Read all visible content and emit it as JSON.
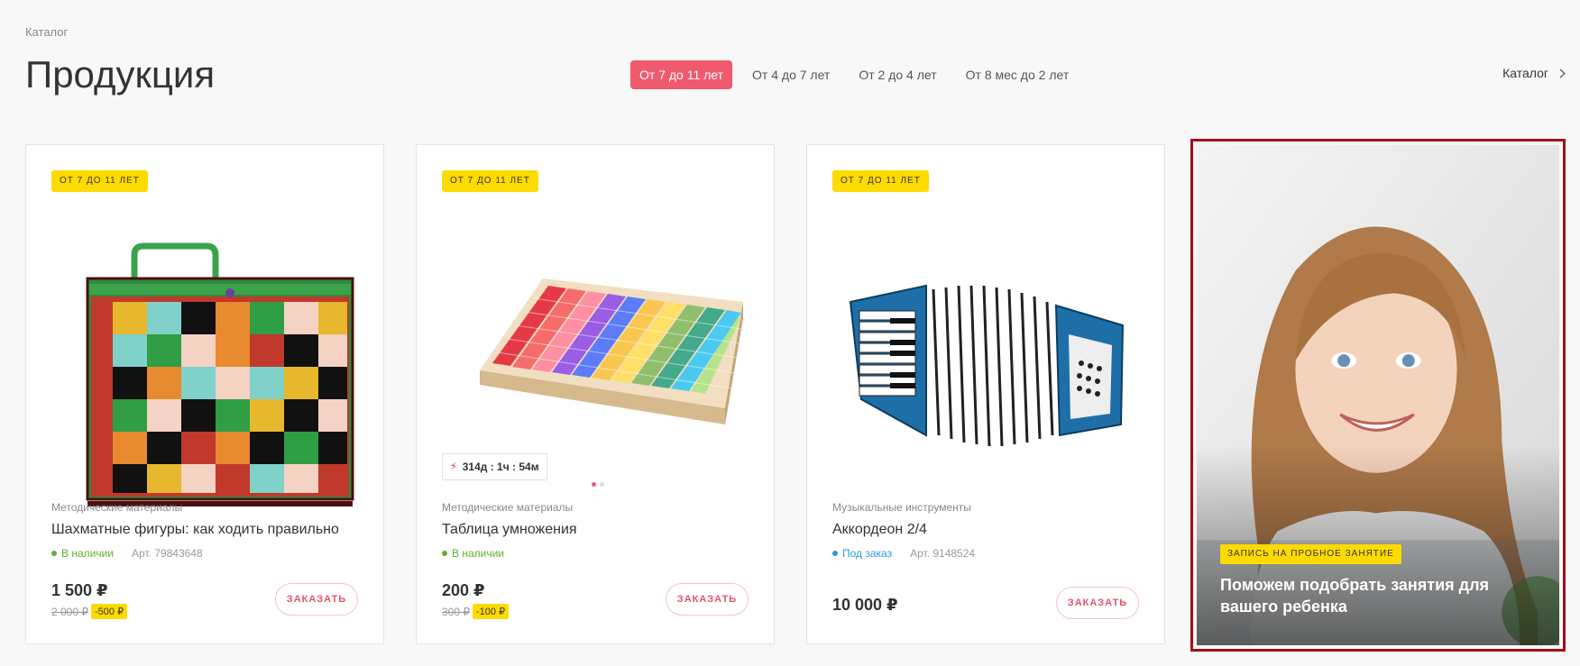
{
  "breadcrumb": "Каталог",
  "title": "Продукция",
  "filters": [
    "От 7 до 11 лет",
    "От 4 до 7 лет",
    "От 2 до 4 лет",
    "От 8 мес до 2 лет"
  ],
  "catalog_link": "Каталог",
  "order_label": "ЗАКАЗАТЬ",
  "products": [
    {
      "badge": "ОТ 7 ДО 11 ЛЕТ",
      "category": "Методические материалы",
      "name": "Шахматные фигуры: как ходить правильно",
      "stock": "В наличии",
      "article": "Арт. 79843648",
      "price": "1 500 ₽",
      "old_price": "2 000 ₽",
      "discount": "-500 ₽"
    },
    {
      "badge": "ОТ 7 ДО 11 ЛЕТ",
      "category": "Методические материалы",
      "name": "Таблица умножения",
      "stock": "В наличии",
      "price": "200 ₽",
      "old_price": "300 ₽",
      "discount": "-100 ₽",
      "timer": "314д : 1ч : 54м"
    },
    {
      "badge": "ОТ 7 ДО 11 ЛЕТ",
      "category": "Музыкальные инструменты",
      "name": "Аккордеон 2/4",
      "stock": "Под заказ",
      "article": "Арт. 9148524",
      "price": "10 000 ₽"
    }
  ],
  "promo": {
    "badge": "ЗАПИСЬ НА ПРОБНОЕ ЗАНЯТИЕ",
    "text": "Поможем подобрать занятия для вашего ребенка"
  },
  "colors": {
    "accent": "#ef5a6e",
    "badge_yellow": "#fedb00",
    "in_stock": "#5bb02f",
    "on_order": "#2a9ad9",
    "highlight_border": "#a40f19"
  }
}
